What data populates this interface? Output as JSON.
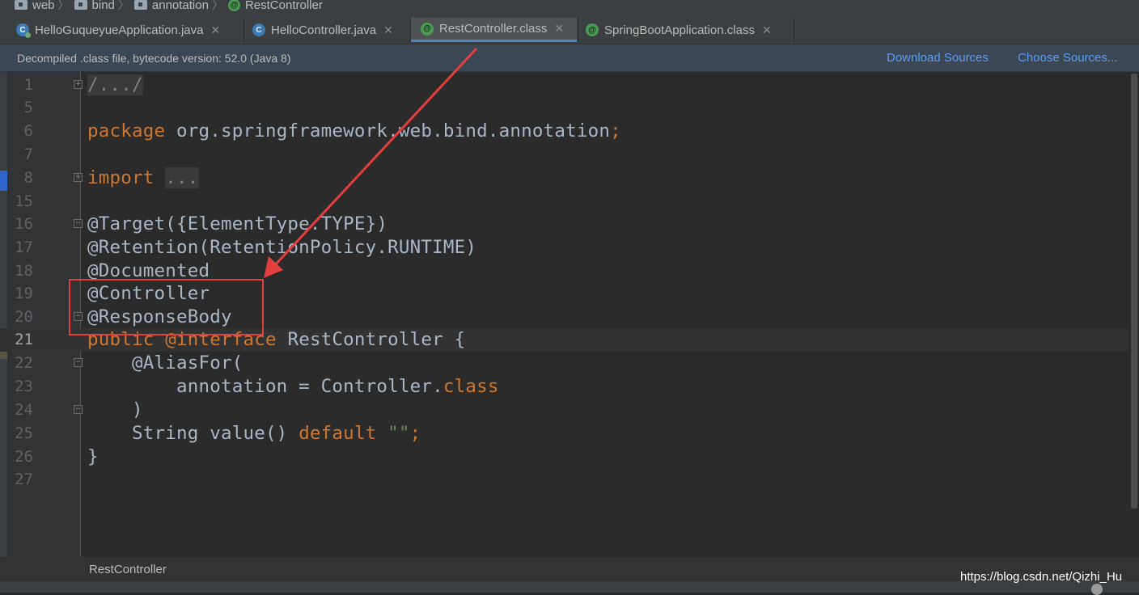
{
  "breadcrumb": {
    "items": [
      {
        "label": "web",
        "icon": "folder-icon"
      },
      {
        "label": "bind",
        "icon": "folder-icon"
      },
      {
        "label": "annotation",
        "icon": "folder-icon"
      },
      {
        "label": "RestController",
        "icon": "annotation-icon"
      }
    ]
  },
  "tabs": [
    {
      "label": "HelloGuqueyueApplication.java",
      "icon": "spring-class-icon",
      "active": false
    },
    {
      "label": "HelloController.java",
      "icon": "class-icon",
      "active": false
    },
    {
      "label": "RestController.class",
      "icon": "annotation-icon",
      "active": true
    },
    {
      "label": "SpringBootApplication.class",
      "icon": "annotation-icon",
      "active": false
    }
  ],
  "banner": {
    "message": "Decompiled .class file, bytecode version: 52.0 (Java 8)",
    "download_sources": "Download Sources",
    "choose_sources": "Choose Sources..."
  },
  "editor": {
    "current_line": "21",
    "line_numbers": [
      "1",
      "5",
      "6",
      "7",
      "8",
      "15",
      "16",
      "17",
      "18",
      "19",
      "20",
      "21",
      "22",
      "23",
      "24",
      "25",
      "26",
      "27"
    ],
    "code": {
      "l1_fold": "/.../",
      "l6_kw": "package",
      "l6_rest": " org.springframework.web.bind.annotation",
      "l6_semi": ";",
      "l8_kw": "import",
      "l8_fold": "...",
      "l16": "@Target({ElementType.TYPE})",
      "l17": "@Retention(RetentionPolicy.RUNTIME)",
      "l18": "@Documented",
      "l19": "@Controller",
      "l20": "@ResponseBody",
      "l21_kw": "public",
      "l21_ann": "@interface",
      "l21_rest": " RestController {",
      "l22": "    @AliasFor(",
      "l23_a": "        annotation = Controller.",
      "l23_kw": "class",
      "l24": "    )",
      "l25_a": "    String value() ",
      "l25_kw": "default",
      "l25_str": "\"\"",
      "l25_semi": ";",
      "l26": "}",
      "l27": ""
    }
  },
  "bottom_breadcrumb": "RestController",
  "watermark": "https://blog.csdn.net/Qizhi_Hu",
  "colors": {
    "keyword": "#cc7832",
    "annotation": "#bbb529",
    "string": "#6a8759",
    "highlight": "#e53e3e",
    "link": "#589df6"
  }
}
